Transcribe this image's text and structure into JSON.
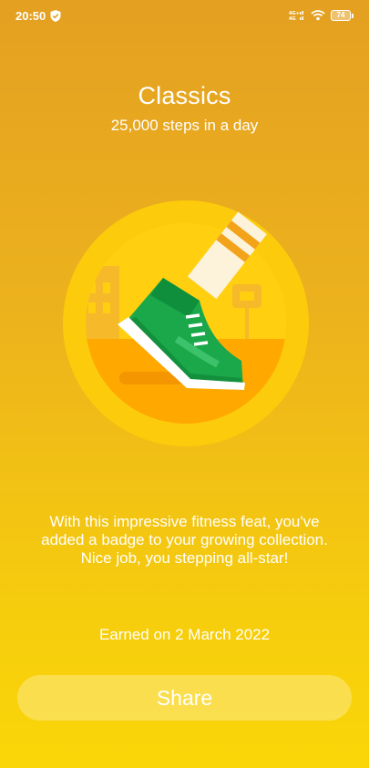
{
  "status_bar": {
    "time": "20:50",
    "network_label": "4G+ 4G",
    "battery": "74"
  },
  "achievement": {
    "title": "Classics",
    "subtitle": "25,000 steps in a day",
    "badge_icon": "sneaker-badge-icon",
    "description_lines": [
      "With this impressive fitness feat, you've",
      "added a badge to your growing collection.",
      "Nice job, you stepping all-star!"
    ],
    "earned_text": "Earned on 2 March 2022"
  },
  "actions": {
    "share_label": "Share"
  },
  "colors": {
    "background_top": "#e4a021",
    "background_bottom": "#fad608",
    "badge_outer": "#fccb0c",
    "badge_inner": "#ffa800",
    "shoe_green": "#1aa84a"
  }
}
